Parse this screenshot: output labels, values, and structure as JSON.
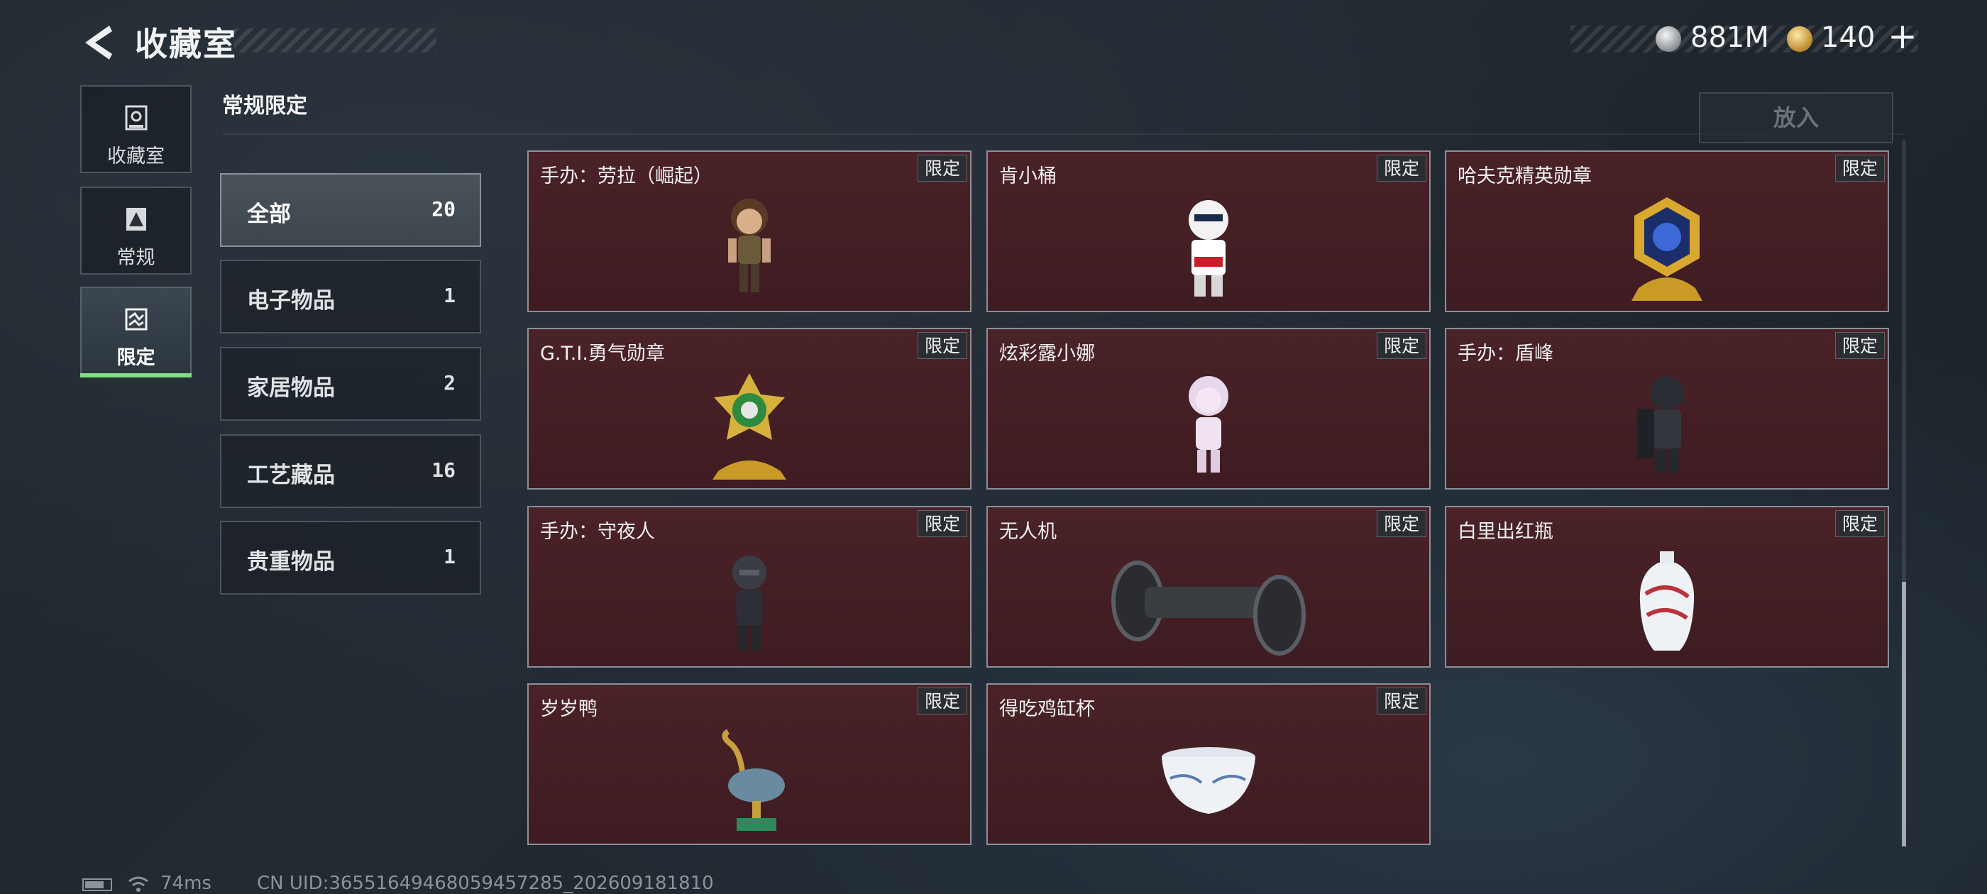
{
  "header": {
    "title": "收藏室",
    "silver_amount": "881M",
    "gold_amount": "140",
    "add_symbol": "+"
  },
  "rail": [
    {
      "label": "收藏室",
      "icon": "collection-icon"
    },
    {
      "label": "常规",
      "icon": "regular-icon"
    },
    {
      "label": "限定",
      "icon": "limited-icon",
      "active": true
    }
  ],
  "section_title": "常规限定",
  "put_button": "放入",
  "categories": [
    {
      "name": "全部",
      "count": "20",
      "active": true
    },
    {
      "name": "电子物品",
      "count": "1"
    },
    {
      "name": "家居物品",
      "count": "2"
    },
    {
      "name": "工艺藏品",
      "count": "16"
    },
    {
      "name": "贵重物品",
      "count": "1"
    }
  ],
  "items": [
    {
      "name": "手办：劳拉（崛起）",
      "tag": "限定",
      "icon": "lara-figure-icon"
    },
    {
      "name": "肯小桶",
      "tag": "限定",
      "icon": "kfc-figure-icon"
    },
    {
      "name": "哈夫克精英勋章",
      "tag": "限定",
      "icon": "gold-medal-icon"
    },
    {
      "name": "G.T.I.勇气勋章",
      "tag": "限定",
      "icon": "green-medal-icon"
    },
    {
      "name": "炫彩露小娜",
      "tag": "限定",
      "icon": "pink-figure-icon"
    },
    {
      "name": "手办：盾峰",
      "tag": "限定",
      "icon": "shield-soldier-icon"
    },
    {
      "name": "手办：守夜人",
      "tag": "限定",
      "icon": "ninja-figure-icon"
    },
    {
      "name": "无人机",
      "tag": "限定",
      "icon": "drone-icon"
    },
    {
      "name": "白里出红瓶",
      "tag": "限定",
      "icon": "porcelain-vase-icon"
    },
    {
      "name": "岁岁鸭",
      "tag": "限定",
      "icon": "duck-statue-icon"
    },
    {
      "name": "得吃鸡缸杯",
      "tag": "限定",
      "icon": "porcelain-cup-icon"
    }
  ],
  "footer": {
    "ping": "74ms",
    "uid": "CN UID:36551649468059457285_202609181810"
  },
  "colors": {
    "card_bg": "#4a2228",
    "active_accent": "#7ee081"
  }
}
